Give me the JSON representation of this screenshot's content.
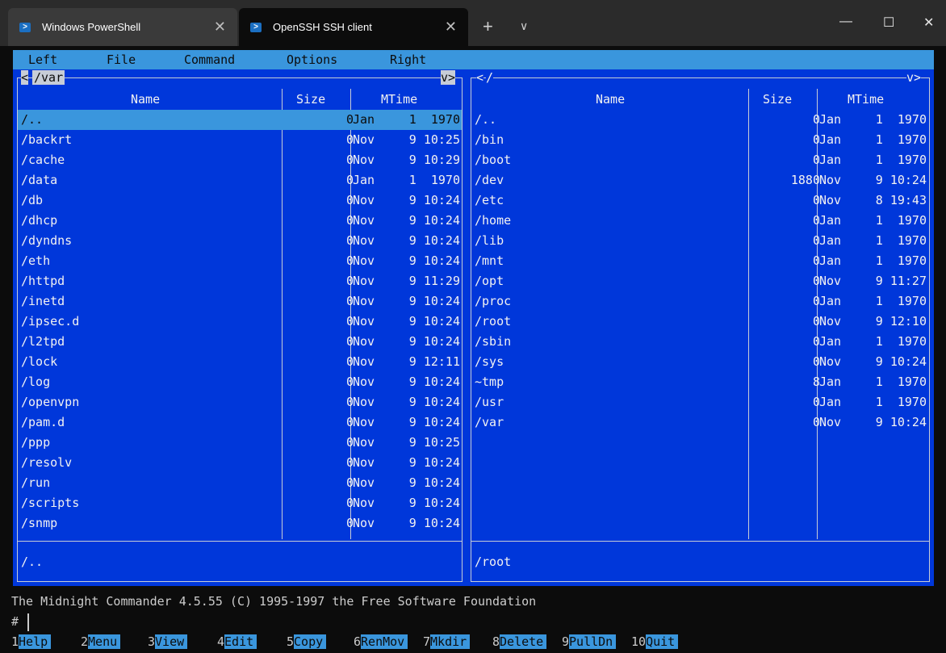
{
  "tabs": [
    {
      "label": "Windows PowerShell",
      "active": false
    },
    {
      "label": "OpenSSH SSH client",
      "active": true
    }
  ],
  "tab_controls": {
    "new_tab": "+",
    "dropdown": "∨"
  },
  "window_controls": {
    "minimize": "—",
    "maximize": "☐",
    "close": "✕"
  },
  "menu": [
    "Left",
    "File",
    "Command",
    "Options",
    "Right"
  ],
  "left_panel": {
    "path": "/var",
    "nav_left": "<",
    "nav_right": "v>",
    "columns": {
      "name": "Name",
      "size": "Size",
      "mtime": "MTime"
    },
    "rows": [
      {
        "name": "/..",
        "size": "0",
        "month": "Jan",
        "time": "1  1970",
        "selected": true
      },
      {
        "name": "/backrt",
        "size": "0",
        "month": "Nov",
        "time": "9 10:25"
      },
      {
        "name": "/cache",
        "size": "0",
        "month": "Nov",
        "time": "9 10:29"
      },
      {
        "name": "/data",
        "size": "0",
        "month": "Jan",
        "time": "1  1970"
      },
      {
        "name": "/db",
        "size": "0",
        "month": "Nov",
        "time": "9 10:24"
      },
      {
        "name": "/dhcp",
        "size": "0",
        "month": "Nov",
        "time": "9 10:24"
      },
      {
        "name": "/dyndns",
        "size": "0",
        "month": "Nov",
        "time": "9 10:24"
      },
      {
        "name": "/eth",
        "size": "0",
        "month": "Nov",
        "time": "9 10:24"
      },
      {
        "name": "/httpd",
        "size": "0",
        "month": "Nov",
        "time": "9 11:29"
      },
      {
        "name": "/inetd",
        "size": "0",
        "month": "Nov",
        "time": "9 10:24"
      },
      {
        "name": "/ipsec.d",
        "size": "0",
        "month": "Nov",
        "time": "9 10:24"
      },
      {
        "name": "/l2tpd",
        "size": "0",
        "month": "Nov",
        "time": "9 10:24"
      },
      {
        "name": "/lock",
        "size": "0",
        "month": "Nov",
        "time": "9 12:11"
      },
      {
        "name": "/log",
        "size": "0",
        "month": "Nov",
        "time": "9 10:24"
      },
      {
        "name": "/openvpn",
        "size": "0",
        "month": "Nov",
        "time": "9 10:24"
      },
      {
        "name": "/pam.d",
        "size": "0",
        "month": "Nov",
        "time": "9 10:24"
      },
      {
        "name": "/ppp",
        "size": "0",
        "month": "Nov",
        "time": "9 10:25"
      },
      {
        "name": "/resolv",
        "size": "0",
        "month": "Nov",
        "time": "9 10:24"
      },
      {
        "name": "/run",
        "size": "0",
        "month": "Nov",
        "time": "9 10:24"
      },
      {
        "name": "/scripts",
        "size": "0",
        "month": "Nov",
        "time": "9 10:24"
      },
      {
        "name": "/snmp",
        "size": "0",
        "month": "Nov",
        "time": "9 10:24"
      }
    ],
    "status": "/.."
  },
  "right_panel": {
    "path": "/",
    "nav_left": "<",
    "nav_right": "v>",
    "columns": {
      "name": "Name",
      "size": "Size",
      "mtime": "MTime"
    },
    "rows": [
      {
        "name": "/..",
        "size": "0",
        "month": "Jan",
        "time": "1  1970"
      },
      {
        "name": "/bin",
        "size": "0",
        "month": "Jan",
        "time": "1  1970"
      },
      {
        "name": "/boot",
        "size": "0",
        "month": "Jan",
        "time": "1  1970"
      },
      {
        "name": "/dev",
        "size": "1880",
        "month": "Nov",
        "time": "9 10:24"
      },
      {
        "name": "/etc",
        "size": "0",
        "month": "Nov",
        "time": "8 19:43"
      },
      {
        "name": "/home",
        "size": "0",
        "month": "Jan",
        "time": "1  1970"
      },
      {
        "name": "/lib",
        "size": "0",
        "month": "Jan",
        "time": "1  1970"
      },
      {
        "name": "/mnt",
        "size": "0",
        "month": "Jan",
        "time": "1  1970"
      },
      {
        "name": "/opt",
        "size": "0",
        "month": "Nov",
        "time": "9 11:27"
      },
      {
        "name": "/proc",
        "size": "0",
        "month": "Jan",
        "time": "1  1970"
      },
      {
        "name": "/root",
        "size": "0",
        "month": "Nov",
        "time": "9 12:10"
      },
      {
        "name": "/sbin",
        "size": "0",
        "month": "Jan",
        "time": "1  1970"
      },
      {
        "name": "/sys",
        "size": "0",
        "month": "Nov",
        "time": "9 10:24"
      },
      {
        "name": "~tmp",
        "size": "8",
        "month": "Jan",
        "time": "1  1970"
      },
      {
        "name": "/usr",
        "size": "0",
        "month": "Jan",
        "time": "1  1970"
      },
      {
        "name": "/var",
        "size": "0",
        "month": "Nov",
        "time": "9 10:24"
      }
    ],
    "status": "/root"
  },
  "hint": "The Midnight Commander 4.5.55 (C) 1995-1997 the Free Software Foundation",
  "prompt": "#",
  "function_keys": [
    {
      "num": "1",
      "label": "Help"
    },
    {
      "num": "2",
      "label": "Menu"
    },
    {
      "num": "3",
      "label": "View"
    },
    {
      "num": "4",
      "label": "Edit"
    },
    {
      "num": "5",
      "label": "Copy"
    },
    {
      "num": "6",
      "label": "RenMov"
    },
    {
      "num": "7",
      "label": "Mkdir"
    },
    {
      "num": "8",
      "label": "Delete"
    },
    {
      "num": "9",
      "label": "PullDn"
    },
    {
      "num": "10",
      "label": "Quit"
    }
  ]
}
